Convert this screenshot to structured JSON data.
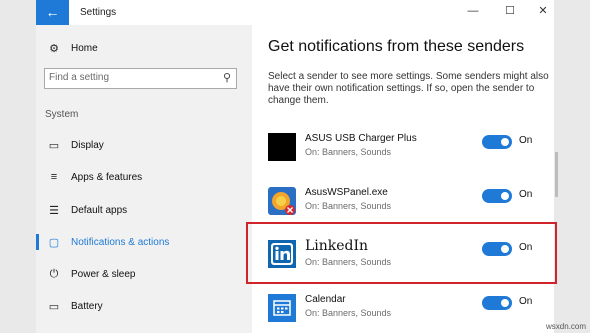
{
  "window": {
    "title": "Settings",
    "back_icon": "arrow-left-icon",
    "controls": [
      "minimize",
      "maximize",
      "close"
    ]
  },
  "sidebar": {
    "home_label": "Home",
    "search_placeholder": "Find a setting",
    "section_label": "System",
    "items": [
      {
        "label": "Display",
        "icon": "monitor-icon"
      },
      {
        "label": "Apps & features",
        "icon": "list-icon"
      },
      {
        "label": "Default apps",
        "icon": "default-apps-icon"
      },
      {
        "label": "Notifications & actions",
        "icon": "notification-icon",
        "selected": true
      },
      {
        "label": "Power & sleep",
        "icon": "power-icon"
      },
      {
        "label": "Battery",
        "icon": "battery-icon"
      }
    ]
  },
  "main": {
    "heading": "Get notifications from these senders",
    "description": "Select a sender to see more settings. Some senders might also have their own notification settings. If so, open the sender to change them.",
    "senders": [
      {
        "name": "ASUS USB Charger Plus",
        "sub": "On: Banners, Sounds",
        "toggle": "On"
      },
      {
        "name": "AsusWSPanel.exe",
        "sub": "On: Banners, Sounds",
        "toggle": "On"
      },
      {
        "name": "LinkedIn",
        "sub": "On: Banners, Sounds",
        "toggle": "On",
        "highlighted": true
      },
      {
        "name": "Calendar",
        "sub": "On: Banners, Sounds",
        "toggle": "On"
      }
    ]
  },
  "colors": {
    "accent": "#1e7ad6",
    "highlight": "#d0232a",
    "linkedin": "#0e66b0"
  },
  "watermark": "wsxdn.com"
}
